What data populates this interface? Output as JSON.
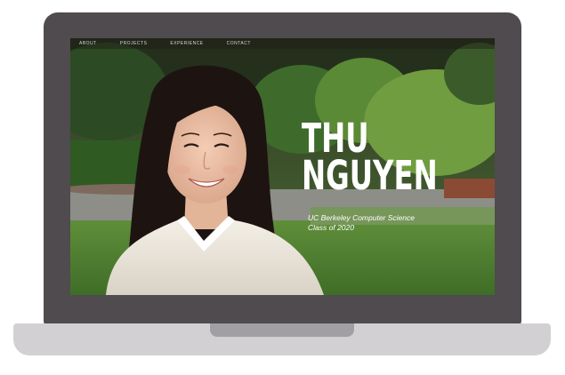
{
  "nav": {
    "items": [
      "ABOUT",
      "PROJECTS",
      "EXPERIENCE",
      "CONTACT"
    ]
  },
  "hero": {
    "first_name": "THU",
    "last_name": "NGUYEN",
    "subtitle_line1": "UC Berkeley Computer Science",
    "subtitle_line2": "Class of 2020"
  },
  "colors": {
    "laptop_lid": "#4f4b4e",
    "laptop_base": "#d3d0d3",
    "hinge": "#a19fa3",
    "heading_text": "#ffffff"
  }
}
